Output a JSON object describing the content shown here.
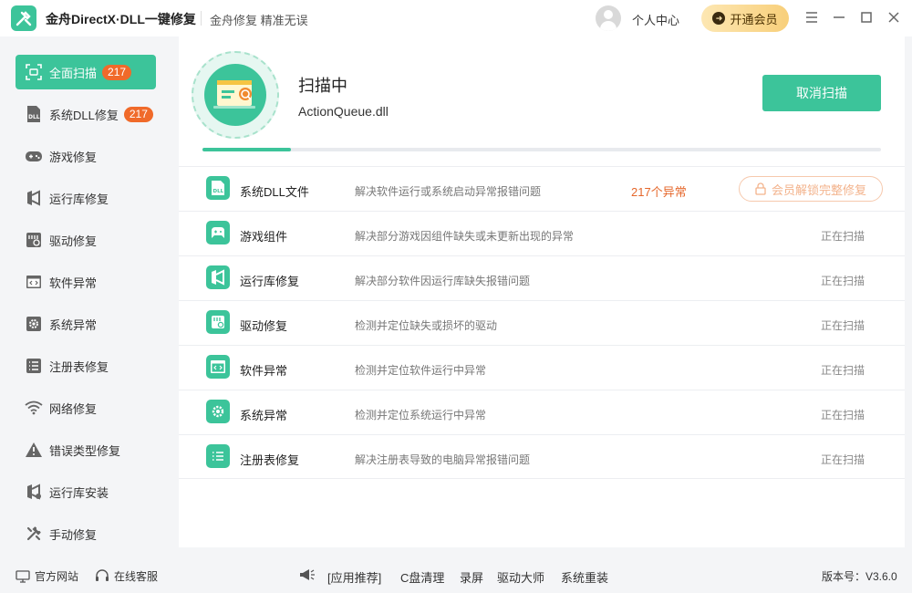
{
  "titlebar": {
    "app_title": "金舟DirectX·DLL一键修复",
    "slogan": "金舟修复 精准无误",
    "user_center": "个人中心",
    "vip_label": "开通会员"
  },
  "sidebar": {
    "items": [
      {
        "label": "全面扫描",
        "badge": "217",
        "icon": "scan-icon"
      },
      {
        "label": "系统DLL修复",
        "badge": "217",
        "icon": "dll-icon"
      },
      {
        "label": "游戏修复",
        "icon": "gamepad-icon"
      },
      {
        "label": "运行库修复",
        "icon": "runtime-icon"
      },
      {
        "label": "驱动修复",
        "icon": "driver-icon"
      },
      {
        "label": "软件异常",
        "icon": "code-window-icon"
      },
      {
        "label": "系统异常",
        "icon": "gear-icon"
      },
      {
        "label": "注册表修复",
        "icon": "list-icon"
      },
      {
        "label": "网络修复",
        "icon": "wifi-icon"
      },
      {
        "label": "错误类型修复",
        "icon": "warning-icon"
      },
      {
        "label": "运行库安装",
        "icon": "runtime-install-icon"
      },
      {
        "label": "手动修复",
        "icon": "wrench-icon"
      }
    ]
  },
  "scan": {
    "title": "扫描中",
    "current_file": "ActionQueue.dll",
    "cancel_label": "取消扫描",
    "progress": 0.13
  },
  "results": [
    {
      "name": "系统DLL文件",
      "desc": "解决软件运行或系统启动异常报错问题",
      "count": "217个异常",
      "action": "会员解锁完整修复",
      "icon": "dll-file-icon"
    },
    {
      "name": "游戏组件",
      "desc": "解决部分游戏因组件缺失或未更新出现的异常",
      "status": "正在扫描",
      "icon": "game-component-icon"
    },
    {
      "name": "运行库修复",
      "desc": "解决部分软件因运行库缺失报错问题",
      "status": "正在扫描",
      "icon": "runtime-icon"
    },
    {
      "name": "驱动修复",
      "desc": "检测并定位缺失或损坏的驱动",
      "status": "正在扫描",
      "icon": "driver-icon"
    },
    {
      "name": "软件异常",
      "desc": "检测并定位软件运行中异常",
      "status": "正在扫描",
      "icon": "code-window-icon"
    },
    {
      "name": "系统异常",
      "desc": "检测并定位系统运行中异常",
      "status": "正在扫描",
      "icon": "gear-icon"
    },
    {
      "name": "注册表修复",
      "desc": "解决注册表导致的电脑异常报错问题",
      "status": "正在扫描",
      "icon": "list-icon"
    }
  ],
  "footer": {
    "official_site": "官方网站",
    "online_service": "在线客服",
    "recommend_label": "[应用推荐]",
    "recommend_items": [
      "C盘清理",
      "录屏",
      "驱动大师",
      "系统重装"
    ],
    "version": "版本号：V3.6.0"
  },
  "colors": {
    "accent": "#3cc49a",
    "badge": "#f06a2a",
    "warning_text": "#e5672b"
  }
}
